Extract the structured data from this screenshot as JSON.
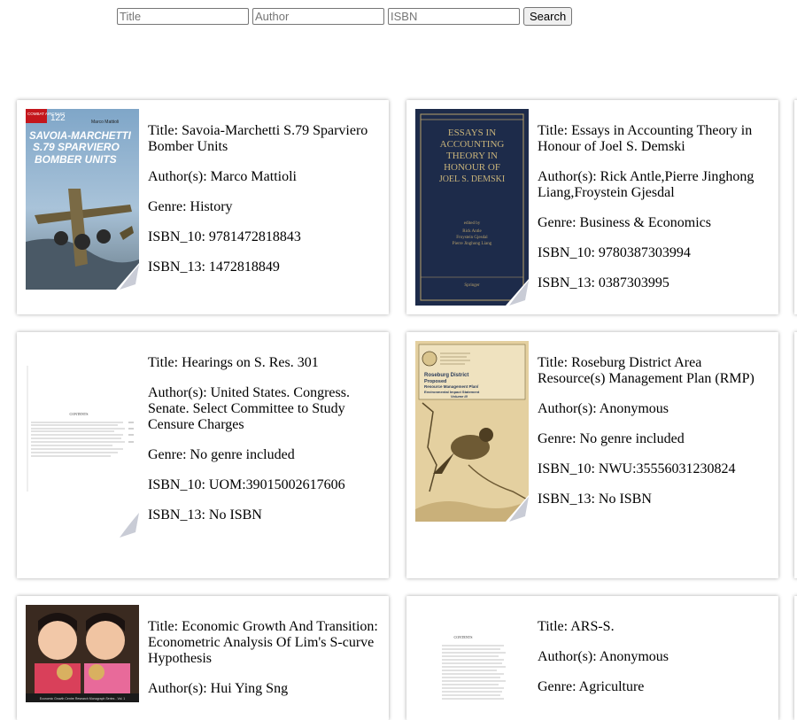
{
  "search": {
    "title_placeholder": "Title",
    "author_placeholder": "Author",
    "isbn_placeholder": "ISBN",
    "button_label": "Search"
  },
  "books": [
    {
      "title": "Title: Savoia-Marchetti S.79 Sparviero Bomber Units",
      "authors": "Author(s): Marco Mattioli",
      "genre": "Genre: History",
      "isbn10": "ISBN_10: 9781472818843",
      "isbn13": "ISBN_13: 1472818849",
      "cover_text": [
        "COMBAT AIRCRAFT",
        "122",
        "Marco Mattioli",
        "SAVOIA-MARCHETTI",
        "S.79 SPARVIERO",
        "BOMBER UNITS"
      ]
    },
    {
      "title": "Title: Essays in Accounting Theory in Honour of Joel S. Demski",
      "authors": "Author(s): Rick Antle,Pierre Jinghong Liang,Froystein Gjesdal",
      "genre": "Genre: Business & Economics",
      "isbn10": "ISBN_10: 9780387303994",
      "isbn13": "ISBN_13: 0387303995",
      "cover_text": [
        "ESSAYS IN",
        "ACCOUNTING",
        "THEORY IN",
        "HONOUR OF",
        "JOEL S. DEMSKI",
        "edited by",
        "Rick Antle",
        "Froystein Gjesdal",
        "Pierre Jinghong Liang",
        "Springer"
      ]
    },
    {
      "title": "Title: Hearings on S. Res. 301",
      "authors": "Author(s): United States. Congress. Senate. Select Committee to Study Censure Charges",
      "genre": "Genre: No genre included",
      "isbn10": "ISBN_10: UOM:39015002617606",
      "isbn13": "ISBN_13: No ISBN",
      "cover_text": [
        "CONTENTS"
      ]
    },
    {
      "title": "Title: Roseburg District Area Resource(s) Management Plan (RMP)",
      "authors": "Author(s): Anonymous",
      "genre": "Genre: No genre included",
      "isbn10": "ISBN_10: NWU:35556031230824",
      "isbn13": "ISBN_13: No ISBN",
      "cover_text": [
        "Roseburg District",
        "Proposed",
        "Resource Management Plan/",
        "Environmental Impact Statement",
        "Volume III"
      ]
    },
    {
      "title": "Title: Economic Growth And Transition: Econometric Analysis Of Lim's S-curve Hypothesis",
      "authors": "Author(s): Hui Ying Sng",
      "genre": "",
      "isbn10": "",
      "isbn13": "",
      "cover_text": [
        "Economic Growth Centre Research Monograph Series - Vol. 1"
      ]
    },
    {
      "title": "Title: ARS-S.",
      "authors": "Author(s): Anonymous",
      "genre": "Genre: Agriculture",
      "isbn10": "",
      "isbn13": "",
      "cover_text": [
        "CONTENTS"
      ]
    }
  ]
}
